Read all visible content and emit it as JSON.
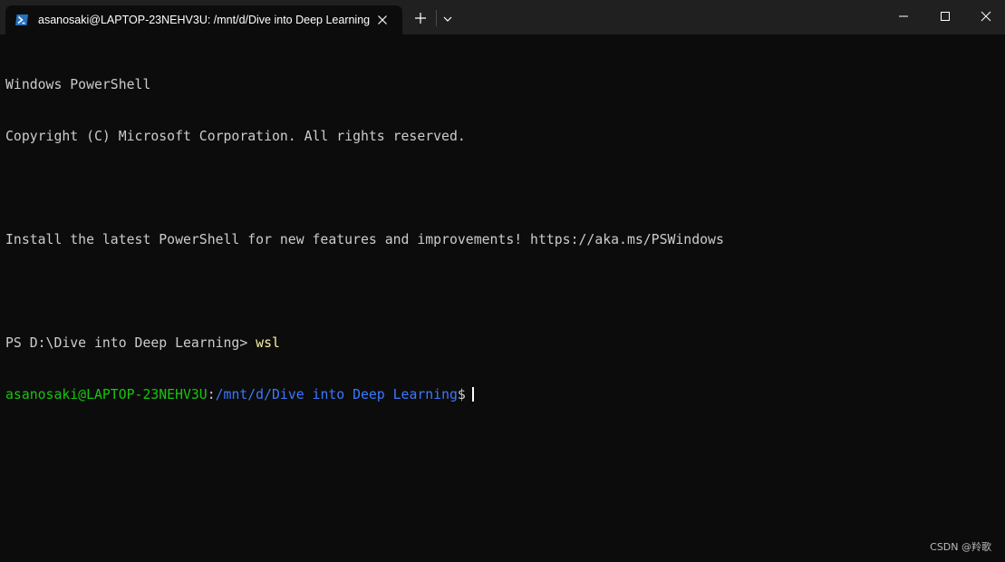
{
  "titlebar": {
    "tab_title": "asanosaki@LAPTOP-23NEHV3U: /mnt/d/Dive into Deep Learning",
    "tab_icon": "powershell-icon",
    "new_tab_icon": "plus-icon",
    "dropdown_icon": "chevron-down-icon",
    "window_controls": [
      "minimize-icon",
      "maximize-icon",
      "close-icon"
    ]
  },
  "terminal": {
    "line1": "Windows PowerShell",
    "line2": "Copyright (C) Microsoft Corporation. All rights reserved.",
    "line3": "",
    "line4": "Install the latest PowerShell for new features and improvements! https://aka.ms/PSWindows",
    "line5": "",
    "ps_prompt": "PS D:\\Dive into Deep Learning> ",
    "ps_command": "wsl",
    "wsl_user": "asanosaki@LAPTOP-23NEHV3U",
    "wsl_colon": ":",
    "wsl_path": "/mnt/d/Dive into Deep Learning",
    "wsl_symbol": "$"
  },
  "watermark": "CSDN @羚歌",
  "colors": {
    "background": "#0c0c0c",
    "titlebar": "#202020",
    "text": "#cccccc",
    "command": "#f9f1a5",
    "user": "#16c60c",
    "path": "#3b78ff"
  }
}
